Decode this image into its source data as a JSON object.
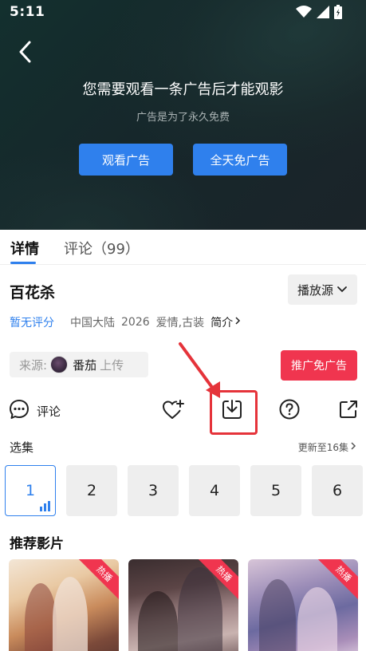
{
  "status_bar": {
    "time": "5:11"
  },
  "ad_overlay": {
    "title": "您需要观看一条广告后才能观影",
    "subtitle": "广告是为了永久免费",
    "watch_button": "观看广告",
    "free_button": "全天免广告"
  },
  "tabs": [
    {
      "label": "详情",
      "active": true
    },
    {
      "label": "评论（99）",
      "active": false
    }
  ],
  "show": {
    "title": "百花杀",
    "source_select": "播放源",
    "rating": "暂无评分",
    "region": "中国大陆",
    "year": "2026",
    "genres": "爱情,古装",
    "intro_link": "简介"
  },
  "uploader": {
    "label": "来源:",
    "name": "番茄",
    "suffix": "上传"
  },
  "promo_button": "推广免广告",
  "actions": {
    "comment_label": "评论"
  },
  "episodes": {
    "label": "选集",
    "update_text": "更新至16集",
    "items": [
      "1",
      "2",
      "3",
      "4",
      "5",
      "6"
    ],
    "active_index": 0
  },
  "recommend": {
    "title": "推荐影片",
    "badge": "热播",
    "count": 3
  },
  "colors": {
    "accent": "#2f80ed",
    "promo": "#f0354f",
    "highlight": "#e5333a"
  }
}
